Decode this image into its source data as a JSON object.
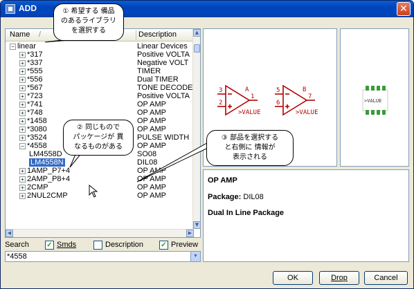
{
  "window": {
    "title": "ADD"
  },
  "list": {
    "headers": {
      "name": "Name",
      "sep_mark": "/",
      "description": "Description"
    },
    "rows": [
      {
        "level": 0,
        "exp": "−",
        "name": "linear",
        "desc": "Linear Devices"
      },
      {
        "level": 1,
        "exp": "+",
        "name": "*317",
        "desc": "Positive VOLTA"
      },
      {
        "level": 1,
        "exp": "+",
        "name": "*337",
        "desc": "Negative VOLT"
      },
      {
        "level": 1,
        "exp": "+",
        "name": "*555",
        "desc": "TIMER"
      },
      {
        "level": 1,
        "exp": "+",
        "name": "*556",
        "desc": "Dual TIMER"
      },
      {
        "level": 1,
        "exp": "+",
        "name": "*567",
        "desc": "TONE DECODE"
      },
      {
        "level": 1,
        "exp": "+",
        "name": "*723",
        "desc": "Positive VOLTA"
      },
      {
        "level": 1,
        "exp": "+",
        "name": "*741",
        "desc": "OP AMP"
      },
      {
        "level": 1,
        "exp": "+",
        "name": "*748",
        "desc": "OP AMP"
      },
      {
        "level": 1,
        "exp": "+",
        "name": "*1458",
        "desc": "OP AMP"
      },
      {
        "level": 1,
        "exp": "+",
        "name": "*3080",
        "desc": "OP AMP"
      },
      {
        "level": 1,
        "exp": "+",
        "name": "*3524",
        "desc": "PULSE WIDTH"
      },
      {
        "level": 1,
        "exp": "−",
        "name": "*4558",
        "desc": "OP AMP"
      },
      {
        "level": 2,
        "exp": "",
        "name": "LM4558D",
        "desc": "SO08"
      },
      {
        "level": 2,
        "exp": "",
        "name": "LM4558N",
        "desc": "DIL08",
        "selected": true
      },
      {
        "level": 1,
        "exp": "+",
        "name": "",
        "desc": ""
      },
      {
        "level": 1,
        "exp": "+",
        "name": "1AMP_P7+4",
        "desc": "OP AMP"
      },
      {
        "level": 1,
        "exp": "+",
        "name": "2AMP_P8+4",
        "desc": "OP AMP"
      },
      {
        "level": 1,
        "exp": "+",
        "name": "2CMP",
        "desc": "OP AMP"
      },
      {
        "level": 1,
        "exp": "+",
        "name": "2NUL2CMP",
        "desc": "OP AMP"
      }
    ]
  },
  "search": {
    "label": "Search",
    "smds_label": "Smds",
    "description_label": "Description",
    "preview_label": "Preview",
    "value": "*4558"
  },
  "info": {
    "description": "OP AMP",
    "package_label": "Package:",
    "package_value": "DIL08",
    "package_desc": "Dual In Line Package"
  },
  "symbol": {
    "gate_a": "A",
    "gate_b": "B",
    "value_a": ">VALUE",
    "value_b": ">VALUE",
    "pins": [
      "3",
      "2",
      "1",
      "5",
      "6",
      "7"
    ],
    "pkg_value": ">VALUE"
  },
  "buttons": {
    "ok": "OK",
    "drop": "Drop",
    "cancel": "Cancel"
  },
  "callouts": {
    "c1": [
      "① 希望する 備品",
      "のあるライブラリ",
      "を選択する"
    ],
    "c2": [
      "② 同じもので",
      "パッケージが 異",
      "なるものがある"
    ],
    "c3": [
      "③ 部品を選択する",
      "と右側に 情報が",
      "表示される"
    ]
  },
  "colors": {
    "selection": "#316ac5",
    "title": "#0a5fd8",
    "pin_green": "#3a9a3a",
    "symbol_red": "#b40000"
  }
}
